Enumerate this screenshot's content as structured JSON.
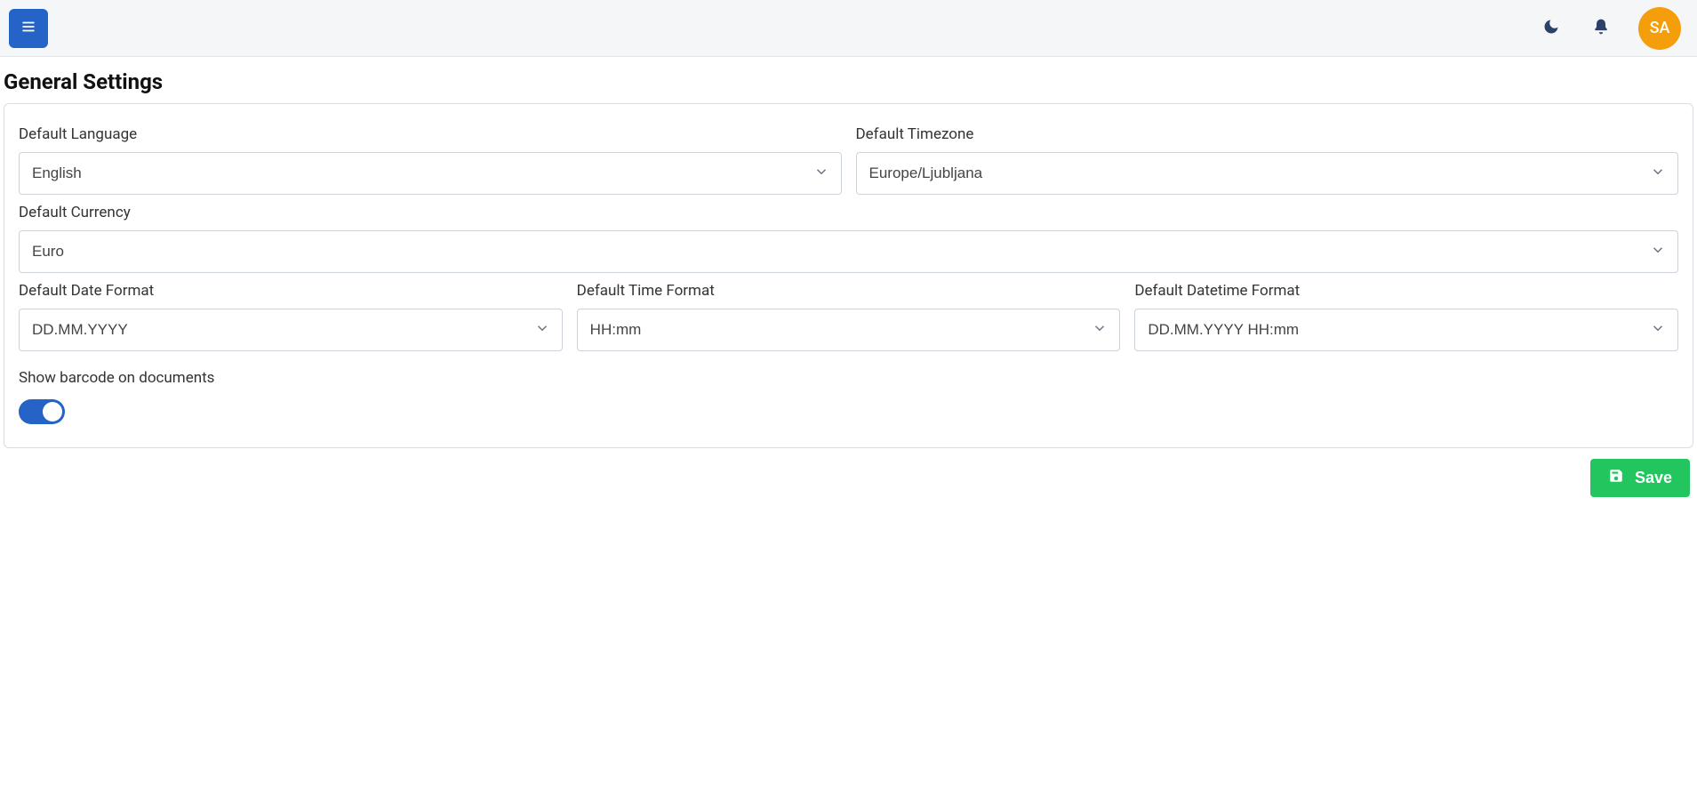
{
  "header": {
    "avatar_initials": "SA"
  },
  "page": {
    "title": "General Settings"
  },
  "form": {
    "language": {
      "label": "Default Language",
      "value": "English"
    },
    "timezone": {
      "label": "Default Timezone",
      "value": "Europe/Ljubljana"
    },
    "currency": {
      "label": "Default Currency",
      "value": "Euro"
    },
    "date_format": {
      "label": "Default Date Format",
      "value": "DD.MM.YYYY"
    },
    "time_format": {
      "label": "Default Time Format",
      "value": "HH:mm"
    },
    "datetime_format": {
      "label": "Default Datetime Format",
      "value": "DD.MM.YYYY HH:mm"
    },
    "barcode": {
      "label": "Show barcode on documents",
      "enabled": true
    }
  },
  "actions": {
    "save_label": "Save"
  }
}
